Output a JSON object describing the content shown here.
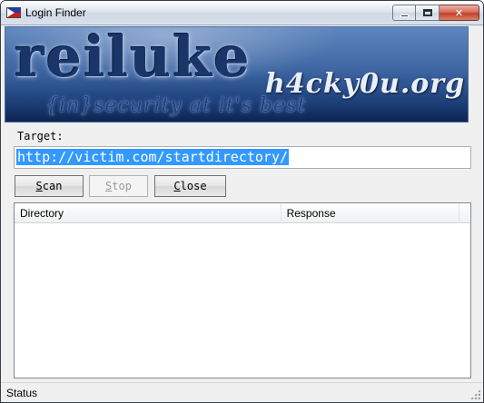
{
  "window": {
    "title": "Login Finder"
  },
  "banner": {
    "logo_text": "reiluke",
    "site_text": "h4cky0u.org",
    "tagline": "{in}security at it's best"
  },
  "target": {
    "label": "Target:",
    "value": "http://victim.com/startdirectory/"
  },
  "buttons": {
    "scan_label_first": "S",
    "scan_label_rest": "can",
    "stop_label_first": "S",
    "stop_label_rest": "top",
    "close_label_first": "C",
    "close_label_rest": "lose"
  },
  "results": {
    "columns": [
      "Directory",
      "Response"
    ],
    "rows": []
  },
  "status": {
    "text": "Status"
  }
}
